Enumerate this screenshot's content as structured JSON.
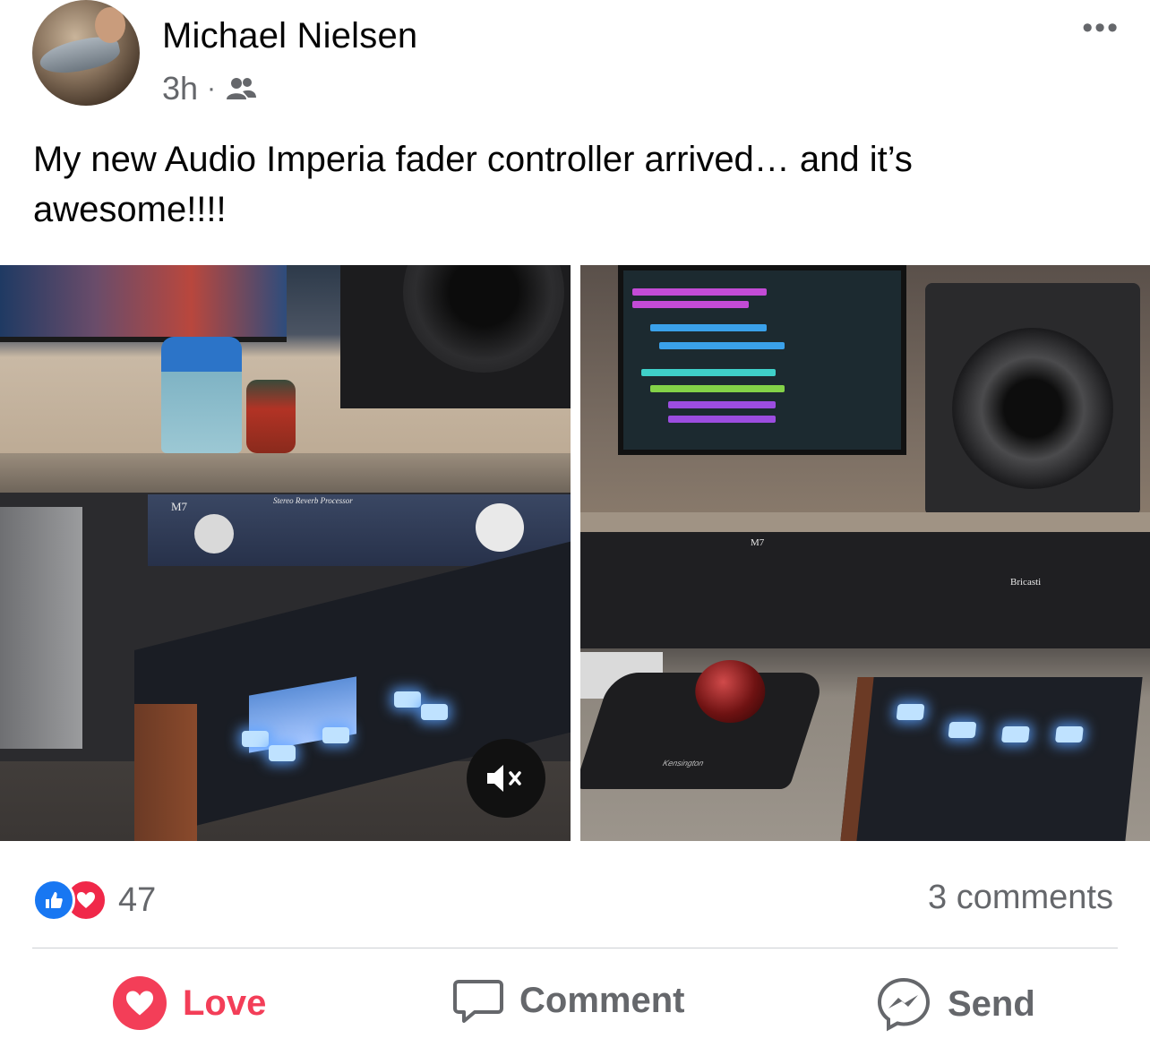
{
  "post": {
    "author": "Michael Nielsen",
    "time": "3h",
    "separator": "·",
    "audience_icon": "friends-icon",
    "more_label": "•••",
    "text": "My new Audio Imperia fader controller arrived… and it’s awesome!!!!"
  },
  "photos": [
    {
      "labels": {
        "rack_model": "M7",
        "rack_title": "Stereo Reverb Processor"
      },
      "muted_icon": "mute-speaker-icon"
    },
    {
      "labels": {
        "rack_model": "M7",
        "brand": "Bricasti",
        "trackball_brand": "Kensington"
      }
    }
  ],
  "footer": {
    "reaction_count": "47",
    "comments_text": "3 comments",
    "actions": {
      "love": "Love",
      "comment": "Comment",
      "send": "Send"
    }
  },
  "colors": {
    "like_blue": "#1877f2",
    "love_red": "#f33e58",
    "secondary_text": "#65676b"
  }
}
